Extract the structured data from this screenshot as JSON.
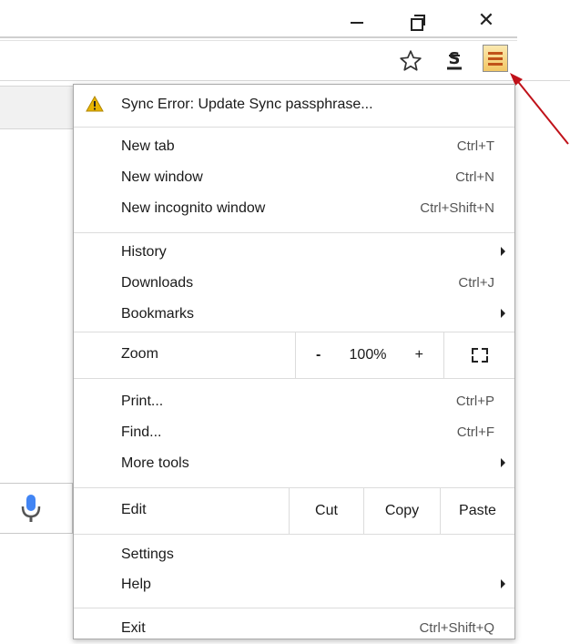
{
  "window": {
    "minimize_icon": "minimize-icon",
    "restore_icon": "restore-icon",
    "close_icon": "close-icon"
  },
  "toolbar": {
    "bookmark_icon": "star-icon",
    "extension_icon": "extension-icon",
    "menu_icon": "hamburger-menu-icon",
    "menu_button_color": "#f2c765"
  },
  "menu": {
    "sync_error": "Sync Error: Update Sync passphrase...",
    "new_tab": {
      "label": "New tab",
      "shortcut": "Ctrl+T"
    },
    "new_window": {
      "label": "New window",
      "shortcut": "Ctrl+N"
    },
    "new_incognito": {
      "label": "New incognito window",
      "shortcut": "Ctrl+Shift+N"
    },
    "history": {
      "label": "History"
    },
    "downloads": {
      "label": "Downloads",
      "shortcut": "Ctrl+J"
    },
    "bookmarks": {
      "label": "Bookmarks"
    },
    "zoom": {
      "label": "Zoom",
      "minus": "-",
      "value": "100%",
      "plus": "+"
    },
    "print": {
      "label": "Print...",
      "shortcut": "Ctrl+P"
    },
    "find": {
      "label": "Find...",
      "shortcut": "Ctrl+F"
    },
    "more_tools": {
      "label": "More tools"
    },
    "edit": {
      "label": "Edit",
      "cut": "Cut",
      "copy": "Copy",
      "paste": "Paste"
    },
    "settings": {
      "label": "Settings"
    },
    "help": {
      "label": "Help"
    },
    "exit": {
      "label": "Exit",
      "shortcut": "Ctrl+Shift+Q"
    }
  },
  "colors": {
    "warning": "#e8b400",
    "arrow": "#c0121a"
  }
}
